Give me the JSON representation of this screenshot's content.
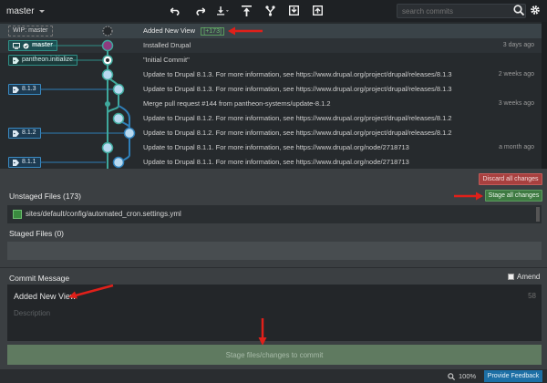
{
  "toolbar": {
    "branch": "master",
    "search_placeholder": "search commits",
    "icons": [
      "undo-icon",
      "redo-icon",
      "pull-icon",
      "push-icon",
      "branch-icon",
      "stash-icon",
      "pop-icon"
    ]
  },
  "graph": {
    "wip_label": "WIP: master",
    "wip_message": "Added New View",
    "wip_count": "+173",
    "rows": [
      {
        "message": "Installed Drupal",
        "time": "3 days ago"
      },
      {
        "message": "\"Initial Commit\"",
        "time": ""
      },
      {
        "message": "Update to Drupal 8.1.3. For more information, see https://www.drupal.org/project/drupal/releases/8.1.3",
        "time": "2 weeks ago"
      },
      {
        "message": "Update to Drupal 8.1.3. For more information, see https://www.drupal.org/project/drupal/releases/8.1.3",
        "time": ""
      },
      {
        "message": "Merge pull request #144 from pantheon-systems/update-8.1.2",
        "time": "3 weeks ago"
      },
      {
        "message": "Update to Drupal 8.1.2. For more information, see https://www.drupal.org/project/drupal/releases/8.1.2",
        "time": ""
      },
      {
        "message": "Update to Drupal 8.1.2. For more information, see https://www.drupal.org/project/drupal/releases/8.1.2",
        "time": ""
      },
      {
        "message": "Update to Drupal 8.1.1. For more information, see https://www.drupal.org/node/2718713",
        "time": "a month ago"
      },
      {
        "message": "Update to Drupal 8.1.1. For more information, see https://www.drupal.org/node/2718713",
        "time": ""
      }
    ],
    "badges": {
      "master": "master",
      "pantheon": "pantheon.initialize",
      "t813": "8.1.3",
      "t812": "8.1.2",
      "t811": "8.1.1"
    }
  },
  "staging": {
    "discard_label": "Discard all changes",
    "unstaged_title": "Unstaged Files (173)",
    "stage_all_label": "Stage all changes",
    "file": "sites/default/config/automated_cron.settings.yml",
    "staged_title": "Staged Files (0)"
  },
  "commit": {
    "title": "Commit Message",
    "amend_label": "Amend",
    "summary": "Added New View",
    "count": "58",
    "description_placeholder": "Description",
    "button_label": "Stage files/changes to commit"
  },
  "status": {
    "zoom": "100%",
    "feedback_label": "Provide Feedback"
  },
  "colors": {
    "accent_green": "#3e7a42",
    "discard_red": "#a8403f",
    "arrow_red": "#e0201a",
    "branch_teal": "#2f8f86"
  }
}
